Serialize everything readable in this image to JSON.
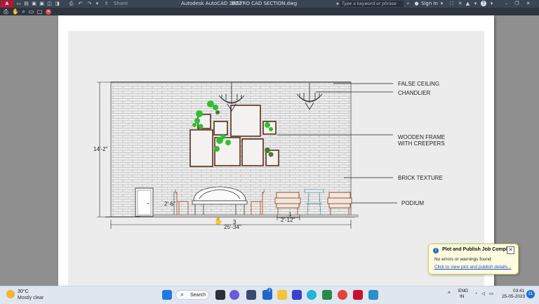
{
  "titlebar": {
    "app_badge": "A CAD",
    "app_title": "Autodesk AutoCAD 2023",
    "file_name": "BISTRO CAD SECTION.dwg",
    "share_label": "Share",
    "search_placeholder": "Type a keyword or phrase",
    "sign_in_label": "Sign In",
    "help_glyph": "?"
  },
  "drawing": {
    "labels": {
      "false_ceiling": "FALSE CEILING",
      "chandlier": "CHANDLIER",
      "wooden_frame_1": "WOODEN FRAME",
      "wooden_frame_2": "WITH CREEPERS",
      "brick_texture": "BRICK TEXTURE",
      "podium": "PODIUM"
    },
    "dimensions": {
      "height": "14'-2\"",
      "podium_height": "2'-6\"",
      "width_top": "3",
      "width": "25'-34\"",
      "step_top": "1",
      "step": "2'-12\""
    }
  },
  "notification": {
    "title": "Plot and Publish Job Complete",
    "body": "No errors or warnings found",
    "link": "Click to view plot and publish details..."
  },
  "taskbar": {
    "temperature": "30°C",
    "weather": "Mostly clear",
    "search_label": "Search",
    "badge_count": "1",
    "language_1": "ENG",
    "language_2": "IN",
    "time": "03:41",
    "date": "25-05-2023",
    "notification_count": "21"
  },
  "colors": {
    "titlebar_bg": "#3b4452",
    "brand_red": "#c8102e",
    "frame_brown": "#5a2d1a",
    "creeper_green": "#2fbf2f",
    "notif_bg": "#fffbe0",
    "taskbar_bg": "#dfe6ef"
  }
}
